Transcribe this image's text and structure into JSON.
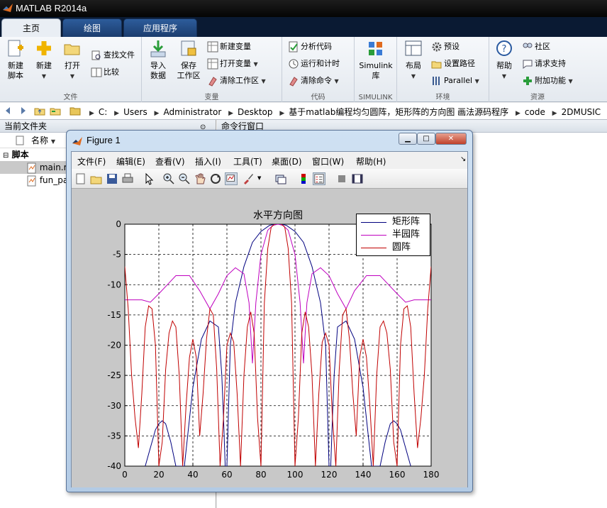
{
  "app": {
    "title": "MATLAB R2014a"
  },
  "tabs": [
    {
      "label": "主页"
    },
    {
      "label": "绘图"
    },
    {
      "label": "应用程序"
    }
  ],
  "ribbon": {
    "file_group": {
      "label": "文件",
      "new_script": "新建\n脚本",
      "new": "新建",
      "open": "打开",
      "find_files": "查找文件",
      "compare": "比较"
    },
    "variable_group": {
      "label": "变量",
      "import": "导入\n数据",
      "save_ws": "保存\n工作区",
      "new_var": "新建变量",
      "open_var": "打开变量",
      "clear_ws": "清除工作区"
    },
    "code_group": {
      "label": "代码",
      "analyze": "分析代码",
      "run_time": "运行和计时",
      "clear_cmd": "清除命令"
    },
    "simulink_group": {
      "label": "SIMULINK",
      "simulink": "Simulink\n库"
    },
    "env_group": {
      "label": "环境",
      "layout": "布局",
      "prefs": "预设",
      "set_path": "设置路径",
      "parallel": "Parallel"
    },
    "resources_group": {
      "label": "资源",
      "help": "帮助",
      "community": "社区",
      "support": "请求支持",
      "addons": "附加功能"
    }
  },
  "address": {
    "path": [
      "C:",
      "Users",
      "Administrator",
      "Desktop",
      "基于matlab编程均匀圆阵，矩形阵的方向图 画法源码程序",
      "code",
      "2DMUSIC"
    ]
  },
  "left_panel": {
    "title": "当前文件夹",
    "column": "名称",
    "folder": "脚本",
    "files": [
      "main.m",
      "fun_pa"
    ]
  },
  "cmd_panel": {
    "title": "命令行窗口"
  },
  "figure": {
    "title": "Figure 1",
    "menu": [
      "文件(F)",
      "编辑(E)",
      "查看(V)",
      "插入(I)",
      "工具(T)",
      "桌面(D)",
      "窗口(W)",
      "帮助(H)"
    ],
    "colors": {
      "rect": "#00007f",
      "semi": "#bf00bf",
      "circle": "#c00000"
    }
  },
  "chart_data": {
    "type": "line",
    "title": "水平方向图",
    "xlabel": "",
    "ylabel": "",
    "xlim": [
      0,
      180
    ],
    "ylim": [
      -40,
      0
    ],
    "xticks": [
      0,
      20,
      40,
      60,
      80,
      100,
      120,
      140,
      160,
      180
    ],
    "yticks": [
      0,
      -5,
      -10,
      -15,
      -20,
      -25,
      -30,
      -35,
      -40
    ],
    "grid": true,
    "legend_position": "top-right",
    "series": [
      {
        "name": "矩形阵",
        "color": "#00007f",
        "x": [
          12,
          15,
          18,
          20,
          22,
          24,
          27,
          30,
          35,
          40,
          45,
          50,
          55,
          57,
          58,
          59,
          60,
          62,
          65,
          70,
          75,
          80,
          85,
          88,
          90,
          92,
          95,
          100,
          105,
          110,
          115,
          118,
          120,
          121,
          122,
          123,
          125,
          130,
          135,
          140,
          145,
          150,
          153,
          156,
          158,
          160,
          162,
          165,
          168
        ],
        "y": [
          -40,
          -37,
          -34,
          -33,
          -32.5,
          -33,
          -36,
          -40,
          -40,
          -27,
          -19,
          -16,
          -17,
          -25,
          -32,
          -40,
          -40,
          -20,
          -13,
          -7,
          -3,
          -1.2,
          -0.2,
          0,
          0,
          0,
          -0.2,
          -1.2,
          -3,
          -7,
          -13,
          -20,
          -40,
          -40,
          -32,
          -25,
          -17,
          -16,
          -19,
          -27,
          -40,
          -40,
          -36,
          -33,
          -32.5,
          -33,
          -34,
          -37,
          -40
        ]
      },
      {
        "name": "半园阵",
        "color": "#bf00bf",
        "x": [
          0,
          10,
          15,
          20,
          25,
          30,
          38,
          44,
          50,
          55,
          60,
          65,
          70,
          73,
          75,
          77,
          80,
          84,
          87,
          90,
          93,
          96,
          100,
          103,
          105,
          107,
          110,
          115,
          120,
          125,
          130,
          135,
          142,
          150,
          155,
          160,
          165,
          170,
          180
        ],
        "y": [
          -12.5,
          -12.5,
          -12.9,
          -11.5,
          -10,
          -8.5,
          -8.5,
          -11,
          -14,
          -11.5,
          -8.5,
          -7.2,
          -8.2,
          -13,
          -23,
          -13,
          -5,
          -1,
          -0.2,
          0,
          -0.2,
          -1,
          -5,
          -13,
          -23,
          -13,
          -8.2,
          -7.2,
          -8.5,
          -11.5,
          -14,
          -11,
          -8.5,
          -8.5,
          -10,
          -11.5,
          -12.9,
          -12.5,
          -12.5
        ]
      },
      {
        "name": "圆阵",
        "color": "#c00000",
        "x": [
          0,
          2,
          4,
          6,
          8,
          10,
          12,
          14,
          16,
          18,
          20,
          22,
          24,
          26,
          28,
          30,
          32,
          34,
          36,
          38,
          40,
          42,
          44,
          46,
          48,
          50,
          52,
          54,
          56,
          58,
          60,
          62,
          64,
          66,
          68,
          70,
          72,
          74,
          76,
          78,
          80,
          82,
          84,
          86,
          88,
          90,
          92,
          94,
          96,
          98,
          100,
          102,
          104,
          106,
          108,
          110,
          112,
          114,
          116,
          118,
          120,
          122,
          124,
          126,
          128,
          130,
          132,
          134,
          136,
          138,
          140,
          142,
          144,
          146,
          148,
          150,
          152,
          154,
          156,
          158,
          160,
          162,
          164,
          166,
          168,
          170,
          172,
          174,
          176,
          178,
          180
        ],
        "y": [
          -7,
          -14,
          -25,
          -32,
          -37,
          -28,
          -17,
          -13.5,
          -14,
          -20,
          -40,
          -36,
          -24,
          -18,
          -16,
          -17,
          -25,
          -40,
          -30,
          -22,
          -19,
          -22,
          -35,
          -28,
          -19,
          -14,
          -15,
          -24,
          -40,
          -32,
          -20,
          -18,
          -19.5,
          -28,
          -40,
          -25,
          -17,
          -14.5,
          -18,
          -32,
          -40,
          -13,
          -4,
          -0.5,
          0,
          0.2,
          0,
          -0.5,
          -4,
          -13,
          -40,
          -32,
          -18,
          -14.5,
          -17,
          -25,
          -40,
          -28,
          -19.5,
          -18,
          -20,
          -32,
          -40,
          -24,
          -15,
          -14,
          -19,
          -28,
          -35,
          -22,
          -19,
          -22,
          -30,
          -40,
          -25,
          -17,
          -16,
          -18,
          -24,
          -36,
          -40,
          -20,
          -14,
          -13.5,
          -17,
          -28,
          -37,
          -32,
          -25,
          -14,
          -7
        ]
      }
    ]
  }
}
